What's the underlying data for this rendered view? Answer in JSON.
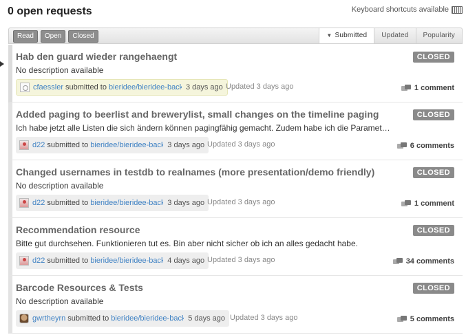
{
  "header": {
    "title": "0 open requests",
    "keyboard_shortcuts": "Keyboard shortcuts available"
  },
  "filters": [
    "Read",
    "Open",
    "Closed"
  ],
  "sorts": [
    "Submitted",
    "Updated",
    "Popularity"
  ],
  "active_sort": "Submitted",
  "requests": [
    {
      "title": "Hab den guard wieder rangehaengt",
      "description": "No description available",
      "status": "CLOSED",
      "author": "cfaessler",
      "submitted_to": "submitted to",
      "repo": "bieridee/bieridee-back",
      "submitted_ago": "3 days ago",
      "updated": "Updated 3 days ago",
      "comments": "1 comment",
      "avatar_icon": "gravatar-icon"
    },
    {
      "title": "Added paging to beerlist and brewerylist, small changes on the timeline paging",
      "description": "Ich habe jetzt alle Listen die sich ändern können pagingfähig gemacht. Zudem habe ich die Paramet…",
      "status": "CLOSED",
      "author": "d22",
      "submitted_to": "submitted to",
      "repo": "bieridee/bieridee-back",
      "submitted_ago": "3 days ago",
      "updated": "Updated 3 days ago",
      "comments": "6 comments",
      "avatar_icon": "user-avatar-icon"
    },
    {
      "title": "Changed usernames in testdb to realnames (more presentation/demo friendly)",
      "description": "No description available",
      "status": "CLOSED",
      "author": "d22",
      "submitted_to": "submitted to",
      "repo": "bieridee/bieridee-back",
      "submitted_ago": "3 days ago",
      "updated": "Updated 3 days ago",
      "comments": "1 comment",
      "avatar_icon": "user-avatar-icon"
    },
    {
      "title": "Recommendation resource",
      "description": "Bitte gut durchsehen. Funktionieren tut es. Bin aber nicht sicher ob ich an alles gedacht habe.",
      "status": "CLOSED",
      "author": "d22",
      "submitted_to": "submitted to",
      "repo": "bieridee/bieridee-back",
      "submitted_ago": "4 days ago",
      "updated": "Updated 3 days ago",
      "comments": "34 comments",
      "avatar_icon": "user-avatar-icon"
    },
    {
      "title": "Barcode Resources & Tests",
      "description": "No description available",
      "status": "CLOSED",
      "author": "gwrtheyrn",
      "submitted_to": "submitted to",
      "repo": "bieridee/bieridee-back",
      "submitted_ago": "5 days ago",
      "updated": "Updated 3 days ago",
      "comments": "5 comments",
      "avatar_icon": "photo-avatar-icon"
    }
  ],
  "colors": {
    "link": "#4183c4",
    "badge": "#8a8a8a",
    "highlight_meta": "#f5f5dc"
  }
}
